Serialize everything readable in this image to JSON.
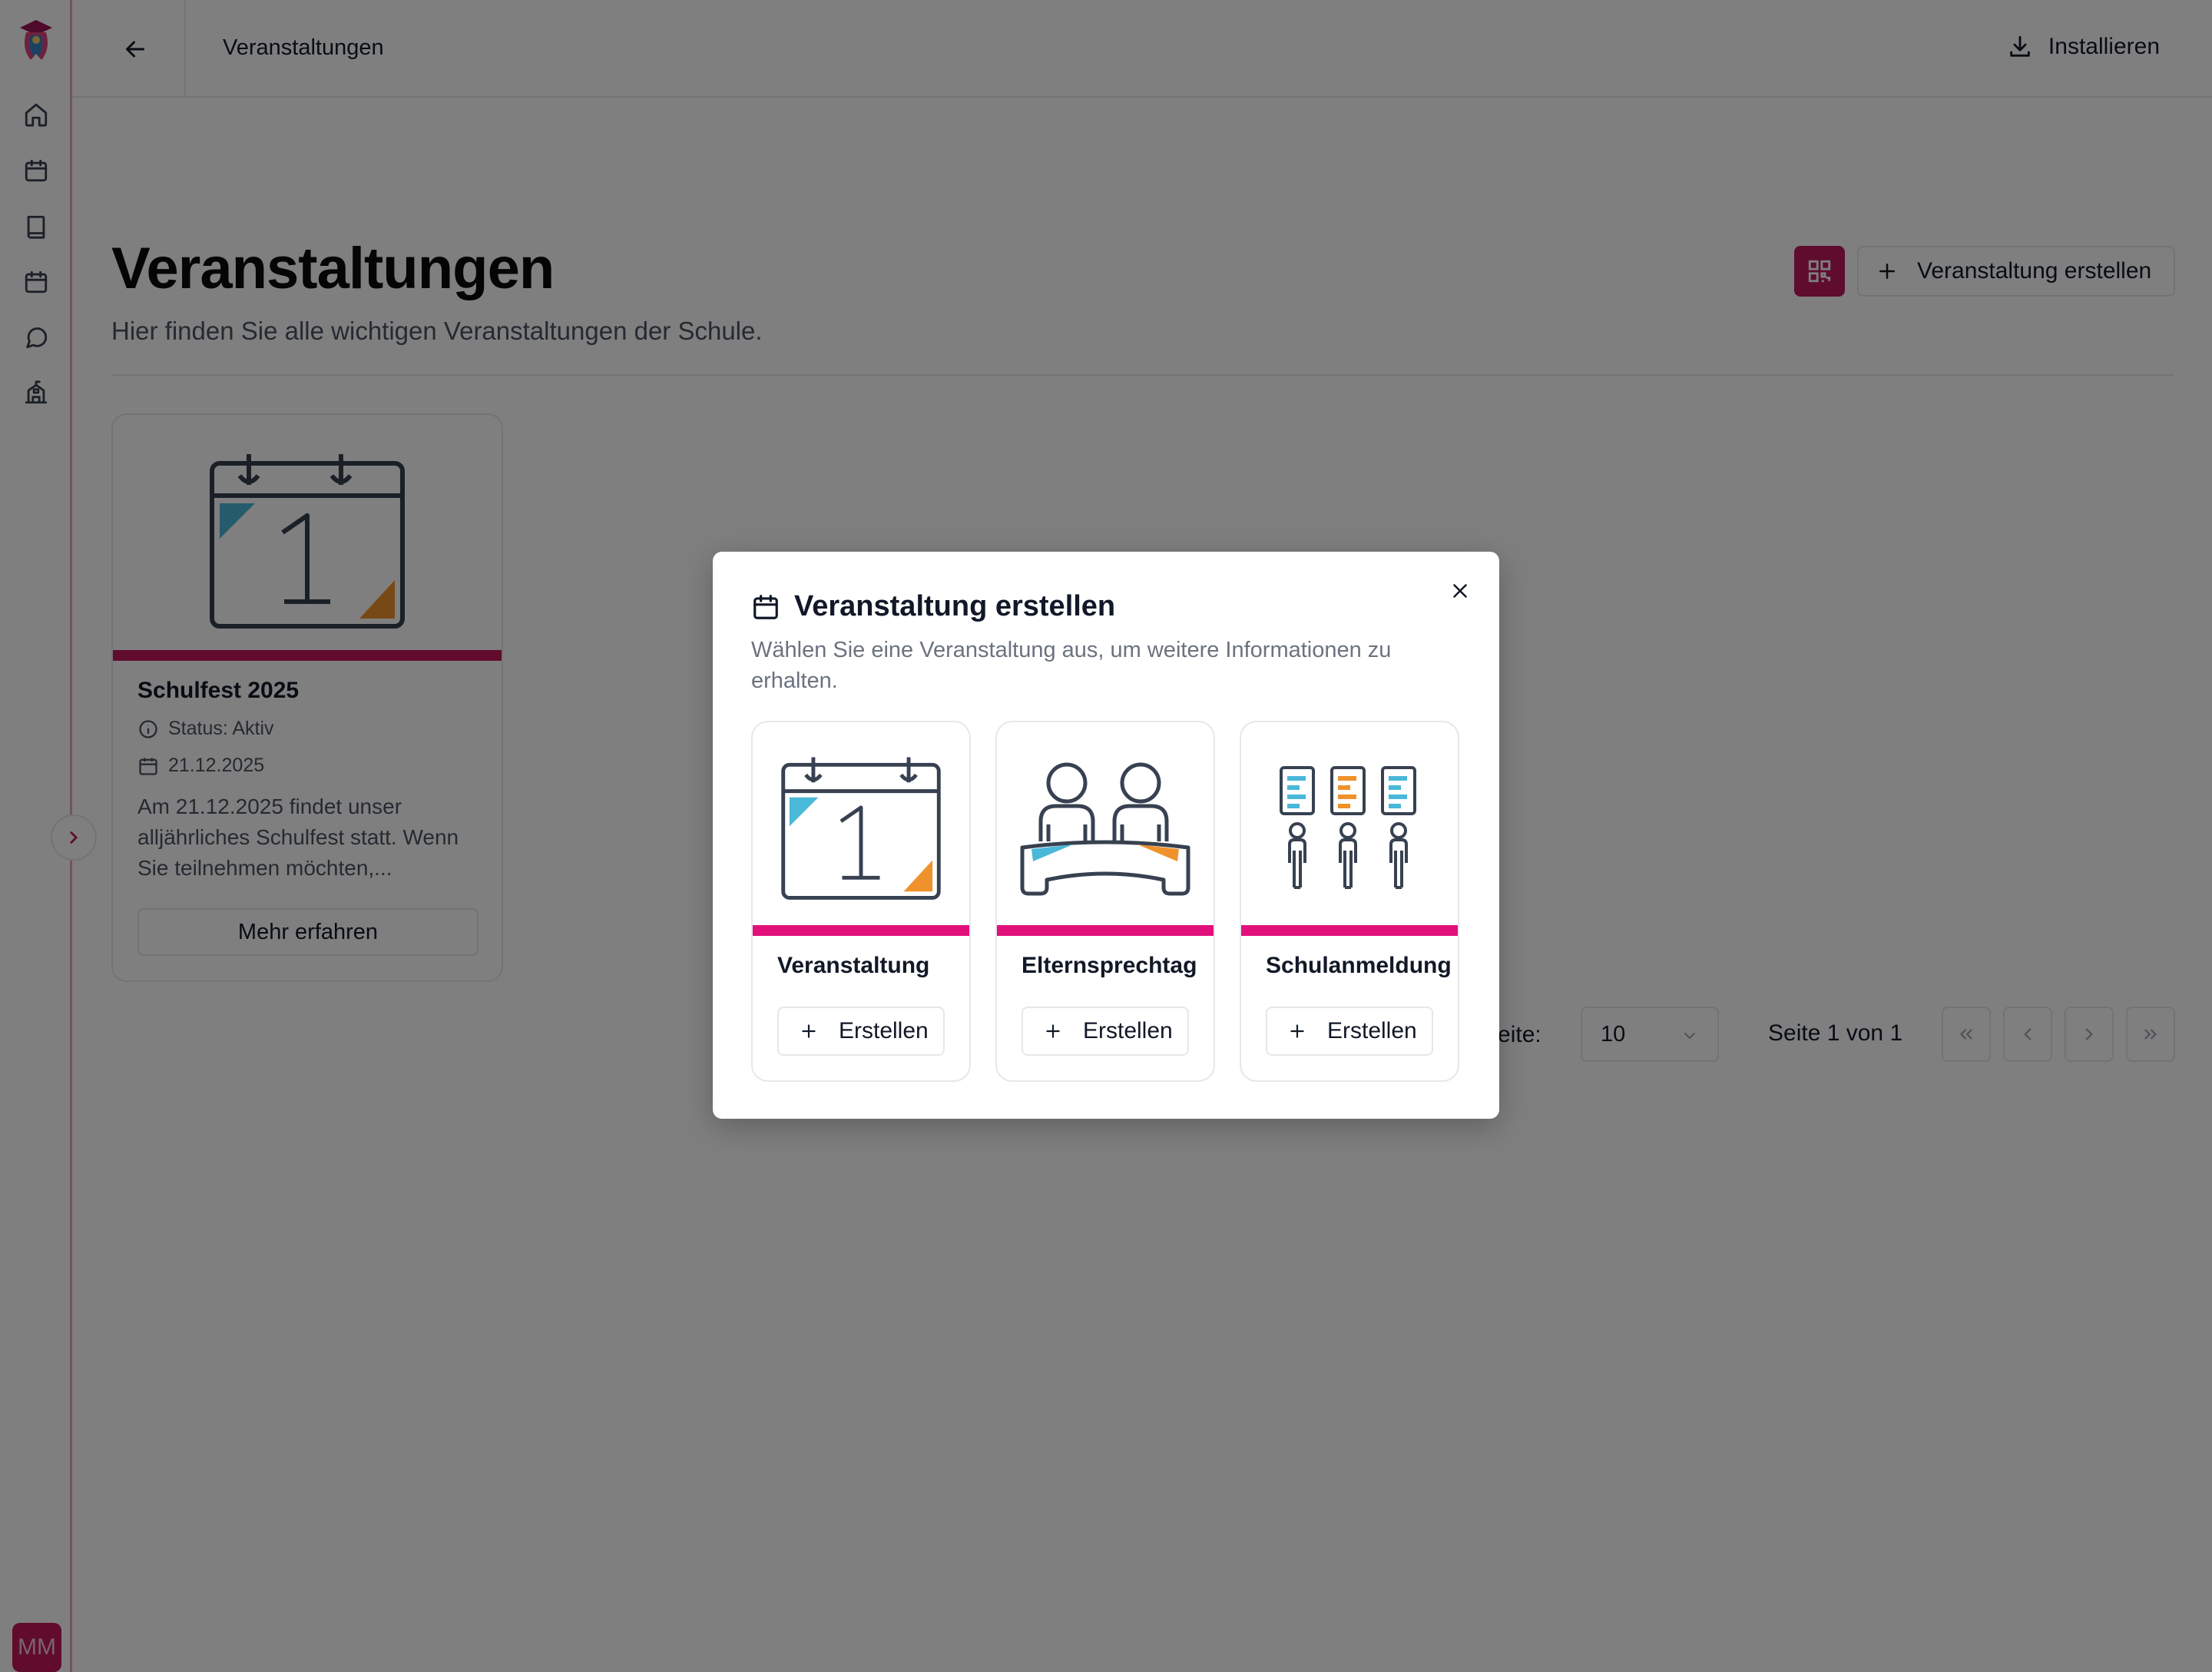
{
  "header": {
    "title": "Veranstaltungen",
    "install_label": "Installieren"
  },
  "main": {
    "title": "Veranstaltungen",
    "subtitle": "Hier finden Sie alle wichtigen Veranstaltungen der Schule.",
    "create_label": "Veranstaltung erstellen"
  },
  "sidebar": {
    "icons": [
      "home-icon",
      "calendar-icon",
      "book-icon",
      "calendar-icon",
      "chat-icon",
      "school-icon"
    ],
    "avatar_initials": "MM"
  },
  "event_card": {
    "title": "Schulfest 2025",
    "status": "Status: Aktiv",
    "date": "21.12.2025",
    "description": "Am 21.12.2025 findet unser alljährliches Schulfest statt. Wenn Sie teilnehmen möchten,...",
    "more_label": "Mehr erfahren"
  },
  "pagination": {
    "per_page_label": "Seite:",
    "per_page_value": "10",
    "page_info": "Seite 1 von 1"
  },
  "modal": {
    "title": "Veranstaltung erstellen",
    "description": "Wählen Sie eine Veranstaltung aus, um weitere Informationen zu erhalten.",
    "options": [
      {
        "title": "Veranstaltung",
        "button": "Erstellen"
      },
      {
        "title": "Elternsprechtag",
        "button": "Erstellen"
      },
      {
        "title": "Schulanmeldung",
        "button": "Erstellen"
      }
    ]
  },
  "colors": {
    "accent": "#c2185b",
    "accent_bright": "#e2107a",
    "teal": "#4ab8d8",
    "orange": "#f0922b"
  }
}
